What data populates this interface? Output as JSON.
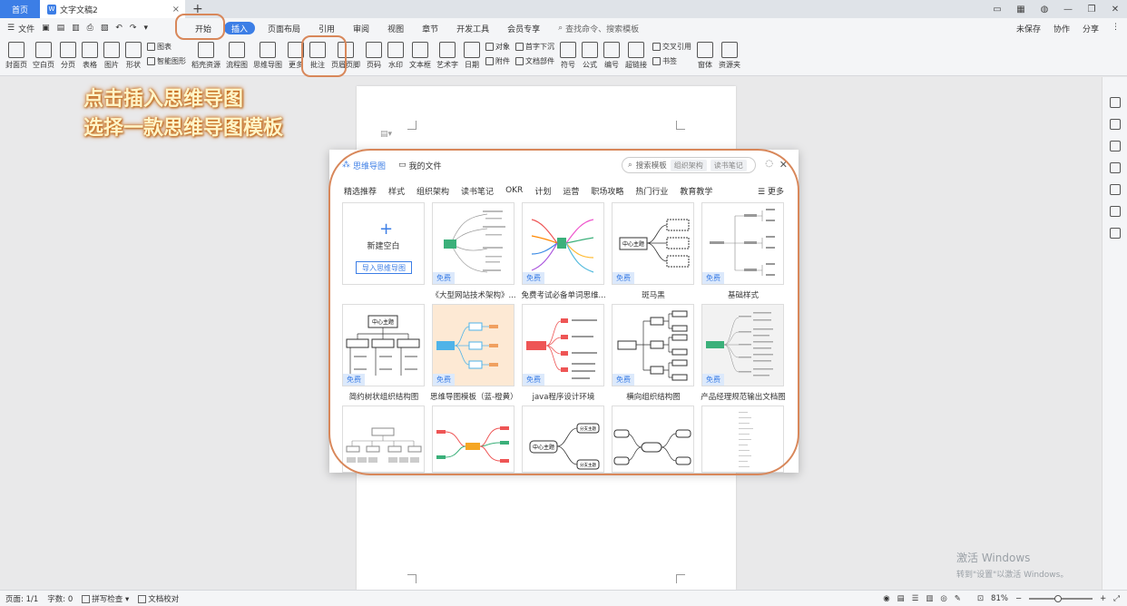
{
  "titlebar": {
    "home_tab": "首页",
    "doc_tab": "文字文稿2",
    "close_glyph": "×",
    "plus_glyph": "+",
    "doc_icon_glyph": "W"
  },
  "menubar": {
    "file_label": "文件",
    "tabs": [
      "开始",
      "插入",
      "页面布局",
      "引用",
      "审阅",
      "视图",
      "章节",
      "开发工具",
      "会员专享"
    ],
    "search_placeholder": "查找命令、搜索模板",
    "right": [
      "未保存",
      "协作",
      "分享"
    ]
  },
  "ribbon": {
    "buttons": [
      "封面页",
      "空白页",
      "分页",
      "表格",
      "图片",
      "形状",
      "稻壳资源",
      "流程图",
      "思维导图",
      "更多",
      "批注",
      "页眉页脚",
      "页码",
      "水印",
      "文本框",
      "艺术字",
      "日期",
      "符号",
      "公式",
      "编号",
      "超链接",
      "窗体",
      "资源夹"
    ],
    "small": {
      "chart": "图表",
      "smart": "智能图形",
      "object": "对象",
      "dropcap": "首字下沉",
      "attach": "附件",
      "docpart": "文档部件",
      "crossref": "交叉引用",
      "bookmark": "书签"
    }
  },
  "annotation": {
    "line1": "点击插入思维导图",
    "line2": "选择一款思维导图模板"
  },
  "dialog": {
    "title": "思维导图",
    "my_files": "我的文件",
    "search_placeholder": "搜索模板",
    "search_chips": [
      "组织架构",
      "读书笔记"
    ],
    "categories": [
      "精选推荐",
      "样式",
      "组织架构",
      "读书笔记",
      "OKR",
      "计划",
      "运营",
      "职场攻略",
      "热门行业",
      "教育教学"
    ],
    "more": "更多",
    "new_blank": "新建空白",
    "import_btn": "导入思维导图",
    "free_badge": "免费",
    "templates_row1": [
      "《大型网站技术架构》...",
      "免费考试必备单词思维...",
      "斑马黑",
      "基础样式"
    ],
    "templates_row2": [
      "简约树状组织结构图",
      "思维导图模板（蓝-橙黄）",
      "java程序设计环境",
      "横向组织结构图",
      "产品经理规范输出文档图"
    ],
    "thumb_center": "中心主题",
    "thumb_branch": "分支主题"
  },
  "statusbar": {
    "page": "页面: 1/1",
    "words": "字数: 0",
    "spell": "拼写检查",
    "proof": "文档校对",
    "zoom": "81%",
    "zoom_level": 0.46
  },
  "watermark": {
    "line1": "激活 Windows",
    "line2": "转到\"设置\"以激活 Windows。"
  },
  "colors": {
    "accent": "#3c7ee6",
    "highlight": "#d8875a"
  }
}
